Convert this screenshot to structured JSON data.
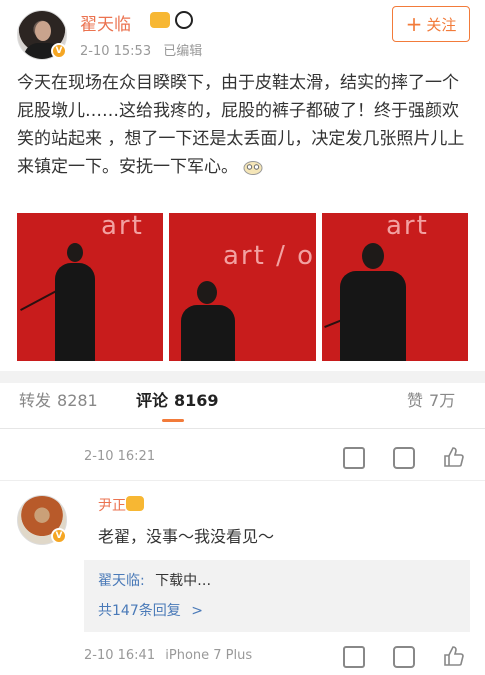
{
  "post": {
    "username": "翟天临",
    "time": "2-10 15:53",
    "edited": "已编辑",
    "follow_label": "关注",
    "follow_plus": "+",
    "text": "今天在现场在众目睽睽下，由于皮鞋太滑，结实的摔了一个屁股墩儿……这给我疼的，屁股的裤子都破了！终于强颜欢笑的站起来 ，想了一下还是太丢面儿，决定发几张照片儿上来镇定一下。安抚一下军心。",
    "emoji": "doge-emoji",
    "photos": [
      {
        "neon": "art"
      },
      {
        "neon": "art / o"
      },
      {
        "neon": "art"
      }
    ]
  },
  "tabs": {
    "repost_label": "转发",
    "repost_count": "8281",
    "comment_label": "评论",
    "comment_count": "8169",
    "like_label": "赞",
    "like_count": "7万"
  },
  "comments": [
    {
      "time": "2-10 16:21"
    },
    {
      "username": "尹正",
      "text": "老翟，没事～我没看见～",
      "reply_name": "翟天临:",
      "reply_text": "下载中…",
      "reply_more": "共147条回复",
      "reply_more_arrow": ">",
      "time": "2-10 16:41",
      "device": "iPhone 7 Plus"
    }
  ],
  "colors": {
    "username": "#eb7350",
    "accent": "#f27b3a",
    "link": "#4a7ab8",
    "photo_bg": "#c81c1c"
  }
}
